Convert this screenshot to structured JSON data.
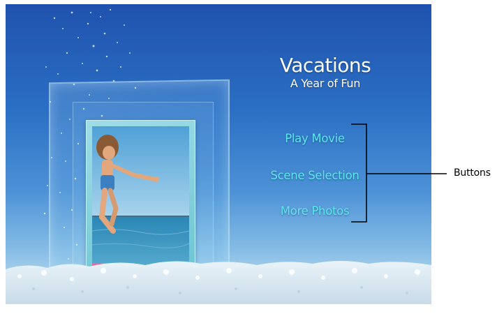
{
  "menu": {
    "title": "Vacations",
    "subtitle": "A Year of Fun",
    "buttons": [
      {
        "label": "Play Movie"
      },
      {
        "label": "Scene Selection"
      },
      {
        "label": "More Photos"
      }
    ]
  },
  "callout": {
    "label": "Buttons"
  },
  "colors": {
    "button_text": "#5ee7ee",
    "title_text": "#ffffff",
    "sky_top": "#1f52ae",
    "sky_bottom": "#cfe6f3",
    "callout_line": "#000000"
  }
}
